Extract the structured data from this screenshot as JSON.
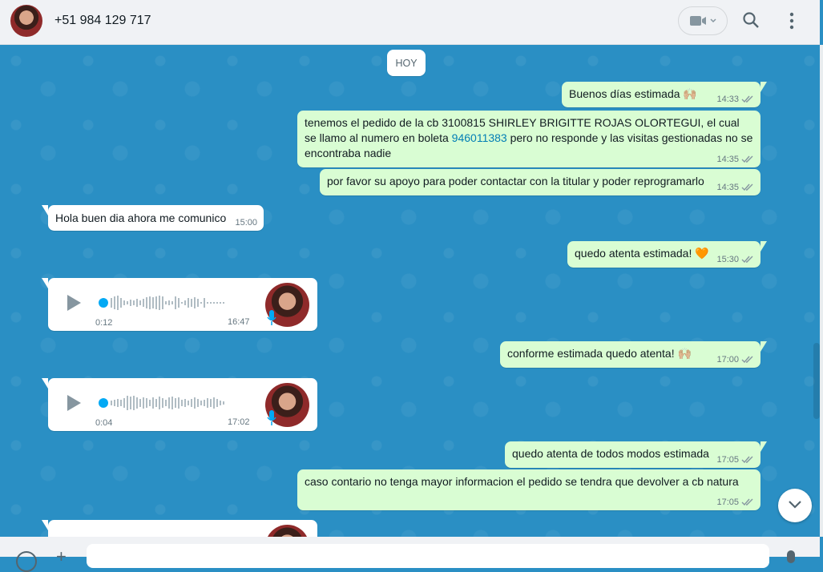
{
  "header": {
    "contact": "+51 984 129 717"
  },
  "date_chip": "HOY",
  "messages": [
    {
      "text": "Buenos días estimada 🙌🏼",
      "time": "14:33"
    },
    {
      "text_a": "tenemos el pedido de la cb 3100815 SHIRLEY BRIGITTE ROJAS OLORTEGUI, el cual se llamo al numero en boleta ",
      "phone": "946011383",
      "text_b": " pero no responde y las visitas gestionadas no se encontraba nadie",
      "time": "14:35"
    },
    {
      "text": "por favor su apoyo para poder contactar con la titular y poder reprogramarlo",
      "time": "14:35"
    },
    {
      "text": "Hola buen dia  ahora me comunico",
      "time": "15:00"
    },
    {
      "text": "quedo atenta estimada! 🧡",
      "time": "15:30"
    },
    {
      "duration": "0:12",
      "time": "16:47"
    },
    {
      "text": "conforme estimada quedo atenta! 🙌🏼",
      "time": "17:00"
    },
    {
      "duration": "0:04",
      "time": "17:02"
    },
    {
      "text": "quedo atenta de todos modos estimada",
      "time": "17:05"
    },
    {
      "text": "caso contario no tenga mayor informacion el pedido se tendra que devolver a cb natura",
      "time": "17:05"
    }
  ],
  "colors": {
    "chat_bg": "#2a8fc4",
    "outgoing_bubble": "#d9fdd3",
    "incoming_bubble": "#ffffff",
    "voice_accent": "#03a9f4",
    "link": "#027eb5"
  },
  "icons": [
    "video-call-icon",
    "search-icon",
    "menu-icon",
    "double-check-icon",
    "play-icon",
    "mic-icon",
    "chevron-down-icon",
    "emoji-icon",
    "attach-icon"
  ]
}
